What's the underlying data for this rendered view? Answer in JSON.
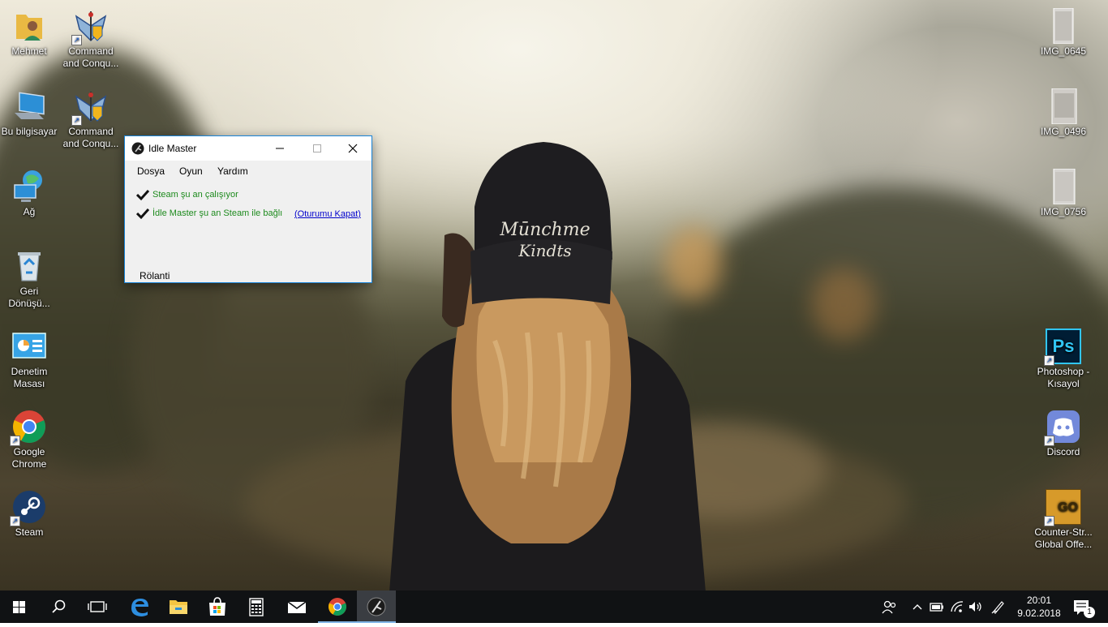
{
  "desktop_icons": {
    "mehmet": "Mehmet",
    "cnc1_line1": "Command",
    "cnc1_line2": "and Conqu...",
    "bu_bilgisayar": "Bu bilgisayar",
    "cnc2_line1": "Command",
    "cnc2_line2": "and Conqu...",
    "ag": "Ağ",
    "geri_line1": "Geri",
    "geri_line2": "Dönüşü...",
    "denetim_line1": "Denetim",
    "denetim_line2": "Masası",
    "chrome_line1": "Google",
    "chrome_line2": "Chrome",
    "steam": "Steam",
    "img_0645": "IMG_0645",
    "img_0496": "IMG_0496",
    "img_0756": "IMG_0756",
    "photoshop_line1": "Photoshop -",
    "photoshop_line2": "Kısayol",
    "ps_glyph": "Ps",
    "discord": "Discord",
    "cs_line1": "Counter-Str...",
    "cs_line2": "Global Offe...",
    "cs_glyph": "GO"
  },
  "window": {
    "title": "Idle Master",
    "menu": [
      "Dosya",
      "Oyun",
      "Yardım"
    ],
    "status_steam": "Steam şu an çalışıyor",
    "status_connected": "İdle Master şu an Steam ile bağlı",
    "logout_link": "(Oturumu Kapat)",
    "idle_status": "Rölanti"
  },
  "taskbar": {
    "icons": [
      "windows-start-icon",
      "search-icon",
      "task-view-icon",
      "edge-icon",
      "file-explorer-icon",
      "store-icon",
      "calculator-icon",
      "mail-icon",
      "chrome-icon",
      "idle-master-icon"
    ],
    "time": "20:01",
    "date": "9.02.2018",
    "notification_count": "1"
  },
  "colors": {
    "accent": "#1883d7",
    "status_green": "#1d8a1d",
    "link": "#0000cc",
    "taskbar": "#101214"
  }
}
